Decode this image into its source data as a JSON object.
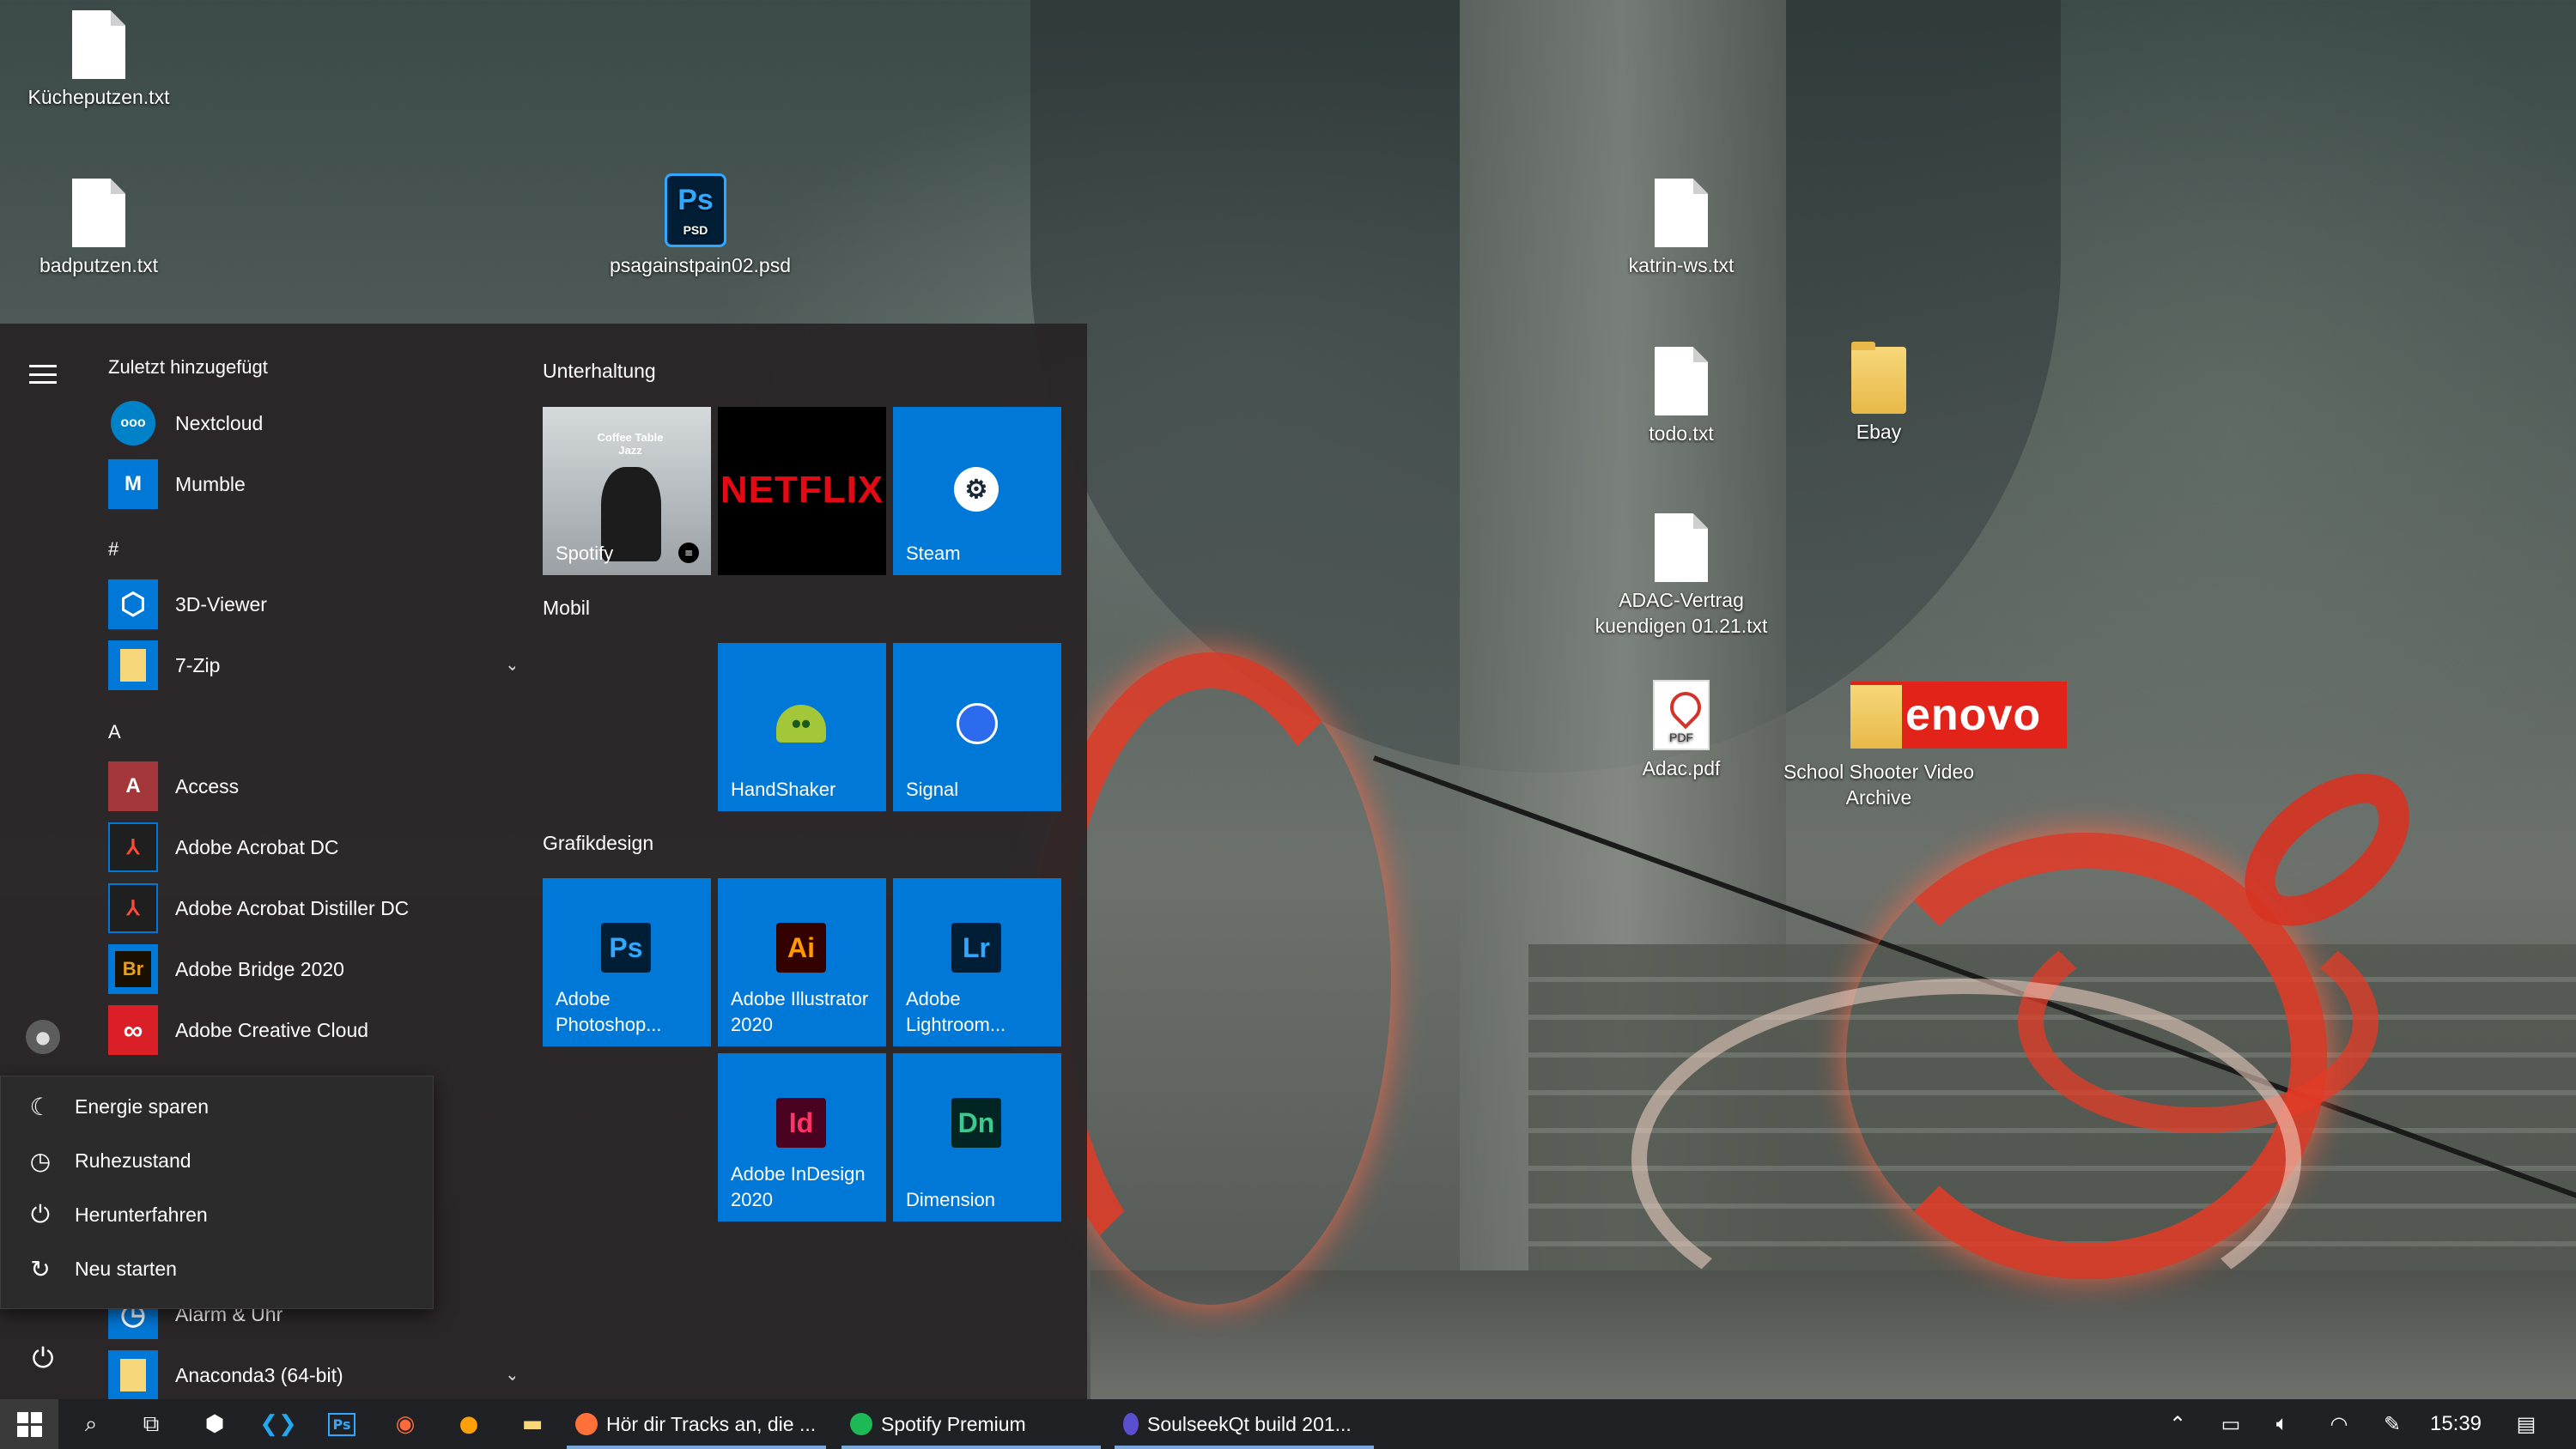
{
  "desktop": {
    "icons": [
      {
        "label": "Kücheputzen.txt"
      },
      {
        "label": "badputzen.txt"
      },
      {
        "label": "psagainstpain02.psd",
        "badge": "Ps",
        "sub": "PSD"
      },
      {
        "label": "katrin-ws.txt"
      },
      {
        "label": "todo.txt"
      },
      {
        "label": "Ebay"
      },
      {
        "label": "ADAC-Vertrag kuendigen 01.21.txt"
      },
      {
        "label": "Adac.pdf",
        "badge": "PDF"
      },
      {
        "label": "School Shooter Video Archive"
      }
    ],
    "lenovo_text": "enovo"
  },
  "start_menu": {
    "recent_header": "Zuletzt hinzugefügt",
    "apps": [
      {
        "label": "Nextcloud",
        "icon": "nextcloud-icon",
        "glyph": "ooo",
        "color": "#0082c9"
      },
      {
        "label": "Mumble",
        "icon": "mumble-icon",
        "glyph": "M",
        "color": "#0078d7"
      },
      {
        "label": "#"
      },
      {
        "label": "3D-Viewer",
        "icon": "cube-icon",
        "glyph": "⬡",
        "color": "#0078d7"
      },
      {
        "label": "7-Zip",
        "icon": "folder-icon",
        "glyph": "",
        "color": "#0078d7"
      },
      {
        "label": "A"
      },
      {
        "label": "Access",
        "icon": "access-icon",
        "glyph": "A",
        "color": "#a4373a"
      },
      {
        "label": "Adobe Acrobat DC",
        "icon": "acrobat-icon",
        "glyph": "⅄",
        "color": "#2b2b2b"
      },
      {
        "label": "Adobe Acrobat Distiller DC",
        "icon": "distiller-icon",
        "glyph": "⅄",
        "color": "#2b2b2b"
      },
      {
        "label": "Adobe Bridge 2020",
        "icon": "bridge-icon",
        "glyph": "Br",
        "color": "#1a1000"
      },
      {
        "label": "Adobe Creative Cloud",
        "icon": "creative-cloud-icon",
        "glyph": "∞",
        "color": "#da1f26"
      },
      {
        "label": "Alarm & Uhr",
        "icon": "clock-icon",
        "glyph": "◷",
        "color": "#0078d7"
      },
      {
        "label": "Anaconda3 (64-bit)",
        "icon": "folder-icon",
        "glyph": "",
        "color": "#0078d7"
      }
    ],
    "groups": {
      "entertainment": "Unterhaltung",
      "mobile": "Mobil",
      "design": "Grafikdesign"
    },
    "tiles": [
      {
        "label": "Spotify",
        "album": "Coffee Table Jazz"
      },
      {
        "label": "NETFLIX"
      },
      {
        "label": "Steam"
      },
      {
        "label": "HandShaker"
      },
      {
        "label": "Signal"
      },
      {
        "label": "Adobe Photoshop...",
        "glyph": "Ps",
        "fg": "#31a8ff",
        "bg": "#001e36"
      },
      {
        "label": "Adobe Illustrator 2020",
        "glyph": "Ai",
        "fg": "#ff9a00",
        "bg": "#330000"
      },
      {
        "label": "Adobe Lightroom...",
        "glyph": "Lr",
        "fg": "#31a8ff",
        "bg": "#001e36"
      },
      {
        "label": "Adobe InDesign 2020",
        "glyph": "Id",
        "fg": "#ff3366",
        "bg": "#49021f"
      },
      {
        "label": "Dimension",
        "glyph": "Dn",
        "fg": "#3dc98f",
        "bg": "#002522"
      }
    ]
  },
  "power_menu": {
    "items": [
      {
        "label": "Energie sparen",
        "icon": "moon-icon",
        "glyph": "☾"
      },
      {
        "label": "Ruhezustand",
        "icon": "clock-icon",
        "glyph": "◷"
      },
      {
        "label": "Herunterfahren",
        "icon": "power-icon",
        "glyph": "⏻"
      },
      {
        "label": "Neu starten",
        "icon": "restart-icon",
        "glyph": "↻"
      }
    ]
  },
  "taskbar": {
    "windows": [
      {
        "label": "Hör dir Tracks an, die ...",
        "icon": "firefox-icon",
        "color": "#ff7139"
      },
      {
        "label": "Spotify Premium",
        "icon": "spotify-icon",
        "color": "#1db954"
      },
      {
        "label": "SoulseekQt build 201...",
        "icon": "soulseek-icon",
        "color": "#5a4fcf"
      }
    ],
    "clock": "15:39"
  }
}
